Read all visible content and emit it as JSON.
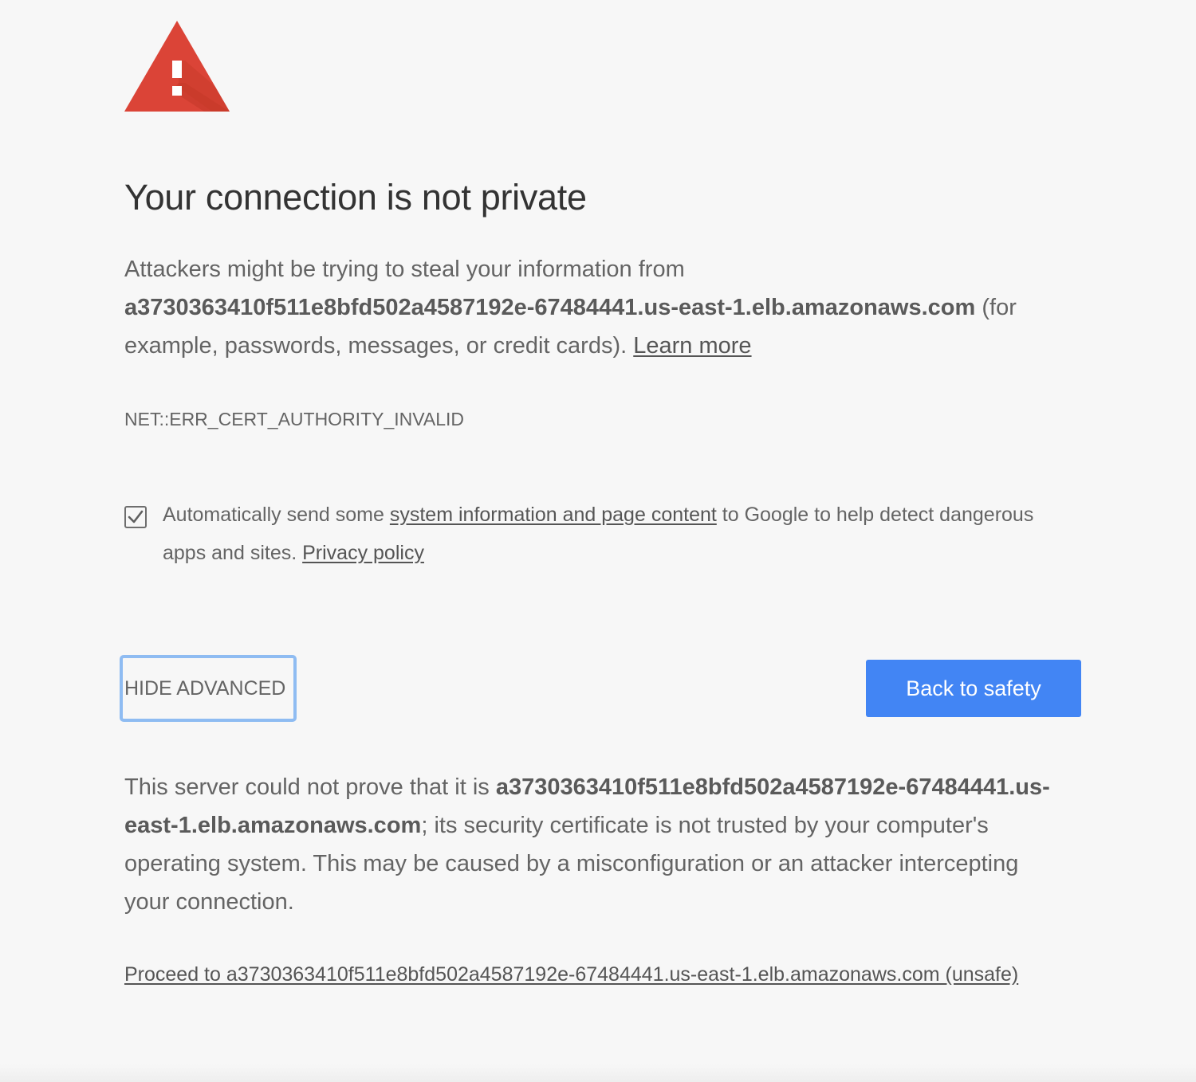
{
  "colors": {
    "background": "#f7f7f7",
    "warning_red": "#db4437",
    "primary_button": "#4285f4",
    "focus_ring": "#8fbcf2",
    "body_text": "#646464",
    "heading_text": "#333333"
  },
  "icon": {
    "warning": "warning-triangle-icon",
    "checkbox": "checkmark-icon"
  },
  "heading": "Your connection is not private",
  "lead": {
    "prefix": "Attackers might be trying to steal your information from ",
    "host": "a3730363410f511e8bfd502a4587192e-67484441.us-east-1.elb.amazonaws.com",
    "suffix": " (for example, passwords, messages, or credit cards). ",
    "learn_more": "Learn more"
  },
  "error_code": "NET::ERR_CERT_AUTHORITY_INVALID",
  "reporting": {
    "checked": true,
    "prefix": "Automatically send some ",
    "link": "system information and page content",
    "middle": " to Google to help detect dangerous apps and sites. ",
    "privacy_link": "Privacy policy"
  },
  "buttons": {
    "hide_advanced": "HIDE ADVANCED",
    "back_to_safety": "Back to safety"
  },
  "advanced": {
    "prefix": "This server could not prove that it is ",
    "host": "a3730363410f511e8bfd502a4587192e-67484441.us-east-1.elb.amazonaws.com",
    "suffix": "; its security certificate is not trusted by your computer's operating system. This may be caused by a misconfiguration or an attacker intercepting your connection."
  },
  "proceed_link": "Proceed to a3730363410f511e8bfd502a4587192e-67484441.us-east-1.elb.amazonaws.com (unsafe)"
}
